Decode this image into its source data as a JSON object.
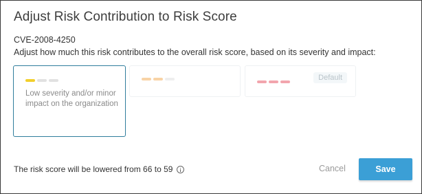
{
  "dialog": {
    "title": "Adjust Risk Contribution to Risk Score",
    "cve": "CVE-2008-4250",
    "description": "Adjust how much this risk contributes to the overall risk score, based on its severity and impact:"
  },
  "options": [
    {
      "text": "Low severity and/or minor impact on the organization",
      "selected": true,
      "bar_colors": [
        "#f2cf2c",
        "#e1e1e1",
        "#e1e1e1"
      ]
    },
    {
      "text": "",
      "selected": false,
      "bar_colors": [
        "#f8d3a6",
        "#f8d3a6",
        "#eeeeee"
      ]
    },
    {
      "text": "",
      "selected": false,
      "badge": "Default",
      "bar_colors": [
        "#f2a5ad",
        "#f2a5ad",
        "#f2a5ad"
      ]
    }
  ],
  "footer": {
    "score_text": "The risk score will be lowered from 66 to 59",
    "cancel_label": "Cancel",
    "save_label": "Save"
  },
  "colors": {
    "selected_border": "#2f7d9c",
    "save_button": "#3b9fd6"
  }
}
